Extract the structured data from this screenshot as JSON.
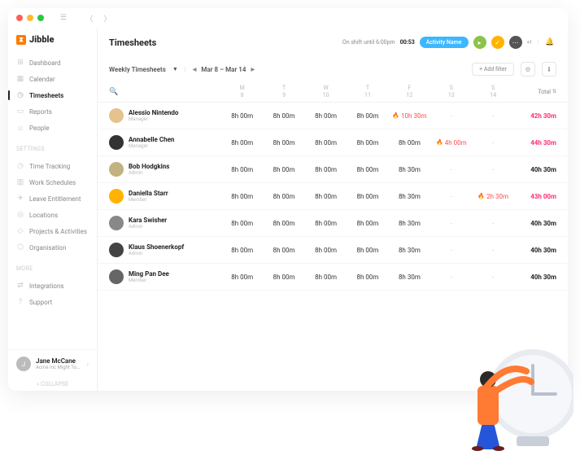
{
  "brand": "Jibble",
  "page_title": "Timesheets",
  "shift_status": "On shift until 6:00pm",
  "timer": "00:53",
  "activity_pill": "Activity Name",
  "plus_count": "+1",
  "sidebar": {
    "main": [
      {
        "icon": "⊞",
        "label": "Dashboard",
        "active": false
      },
      {
        "icon": "▦",
        "label": "Calendar",
        "active": false
      },
      {
        "icon": "◷",
        "label": "Timesheets",
        "active": true
      },
      {
        "icon": "▭",
        "label": "Reports",
        "active": false
      },
      {
        "icon": "☺",
        "label": "People",
        "active": false
      }
    ],
    "settings_label": "SETTINGS",
    "settings": [
      {
        "icon": "◷",
        "label": "Time Tracking"
      },
      {
        "icon": "▥",
        "label": "Work Schedules"
      },
      {
        "icon": "✈",
        "label": "Leave Entitlement"
      },
      {
        "icon": "◎",
        "label": "Locations"
      },
      {
        "icon": "◇",
        "label": "Projects & Activities"
      },
      {
        "icon": "⬡",
        "label": "Organisation"
      }
    ],
    "more_label": "MORE",
    "more": [
      {
        "icon": "⇄",
        "label": "Integrations"
      },
      {
        "icon": "?",
        "label": "Support"
      }
    ]
  },
  "user": {
    "name": "Jane McCane",
    "org": "Acme Inc Might Too Long..."
  },
  "collapse": "« COLLAPSE",
  "toolbar": {
    "view": "Weekly Timesheets",
    "range": "Mar 8 – Mar 14",
    "add_filter": "+ Add filter"
  },
  "columns": [
    {
      "d": "M",
      "n": "8"
    },
    {
      "d": "T",
      "n": "9"
    },
    {
      "d": "W",
      "n": "10"
    },
    {
      "d": "T",
      "n": "11"
    },
    {
      "d": "F",
      "n": "12"
    },
    {
      "d": "S",
      "n": "13"
    },
    {
      "d": "S",
      "n": "14"
    }
  ],
  "total_label": "Total",
  "rows": [
    {
      "name": "Alessio Nintendo",
      "role": "Manager",
      "cells": [
        "8h 00m",
        "8h 00m",
        "8h 00m",
        "8h 00m",
        {
          "ot": true,
          "v": "10h 30m"
        },
        "-",
        "-"
      ],
      "total": "42h 30m",
      "ot": true,
      "color": "#e6c28f"
    },
    {
      "name": "Annabelle Chen",
      "role": "Manager",
      "cells": [
        "8h 00m",
        "8h 00m",
        "8h 00m",
        "8h 00m",
        "8h 00m",
        {
          "ot": true,
          "v": "4h 00m"
        },
        "-"
      ],
      "total": "44h 30m",
      "ot": true,
      "color": "#333"
    },
    {
      "name": "Bob Hodgkins",
      "role": "Admin",
      "cells": [
        "8h 00m",
        "8h 00m",
        "8h 00m",
        "8h 00m",
        "8h 30m",
        "-",
        "-"
      ],
      "total": "40h 30m",
      "ot": false,
      "color": "#c2b280"
    },
    {
      "name": "Daniella Starr",
      "role": "Member",
      "cells": [
        "8h 00m",
        "8h 00m",
        "8h 00m",
        "8h 00m",
        "8h 30m",
        "-",
        {
          "ot": true,
          "v": "2h 30m"
        }
      ],
      "total": "43h 00m",
      "ot": true,
      "color": "#ffb300"
    },
    {
      "name": "Kara Swisher",
      "role": "Admin",
      "cells": [
        "8h 00m",
        "8h 00m",
        "8h 00m",
        "8h 00m",
        "8h 30m",
        "-",
        "-"
      ],
      "total": "40h 30m",
      "ot": false,
      "color": "#888"
    },
    {
      "name": "Klaus Shoenerkopf",
      "role": "Admin",
      "cells": [
        "8h 00m",
        "8h 00m",
        "8h 00m",
        "8h 00m",
        "8h 30m",
        "-",
        "-"
      ],
      "total": "40h 30m",
      "ot": false,
      "color": "#444"
    },
    {
      "name": "Ming Pan Dee",
      "role": "Member",
      "cells": [
        "8h 00m",
        "8h 00m",
        "8h 00m",
        "8h 00m",
        "8h 30m",
        "-",
        "-"
      ],
      "total": "40h 30m",
      "ot": false,
      "color": "#666"
    }
  ]
}
